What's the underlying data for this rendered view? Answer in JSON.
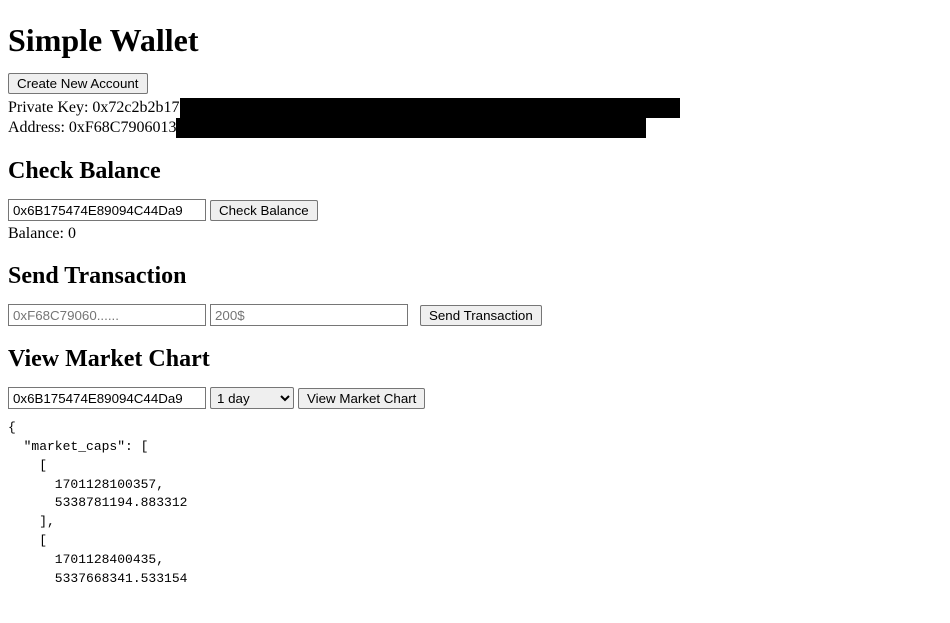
{
  "title": "Simple Wallet",
  "account": {
    "create_label": "Create New Account",
    "pk_label": "Private Key: 0x72c2b2b17",
    "addr_label": "Address: 0xF68C7906013"
  },
  "balance": {
    "heading": "Check Balance",
    "input_value": "0x6B175474E89094C44Da9",
    "button_label": "Check Balance",
    "result_label": "Balance: 0"
  },
  "tx": {
    "heading": "Send Transaction",
    "addr_placeholder": "0xF68C79060......",
    "amount_placeholder": "200$",
    "button_label": "Send Transaction"
  },
  "chart": {
    "heading": "View Market Chart",
    "input_value": "0x6B175474E89094C44Da9",
    "range_selected": "1 day",
    "button_label": "View Market Chart",
    "output": "{\n  \"market_caps\": [\n    [\n      1701128100357,\n      5338781194.883312\n    ],\n    [\n      1701128400435,\n      5337668341.533154"
  }
}
